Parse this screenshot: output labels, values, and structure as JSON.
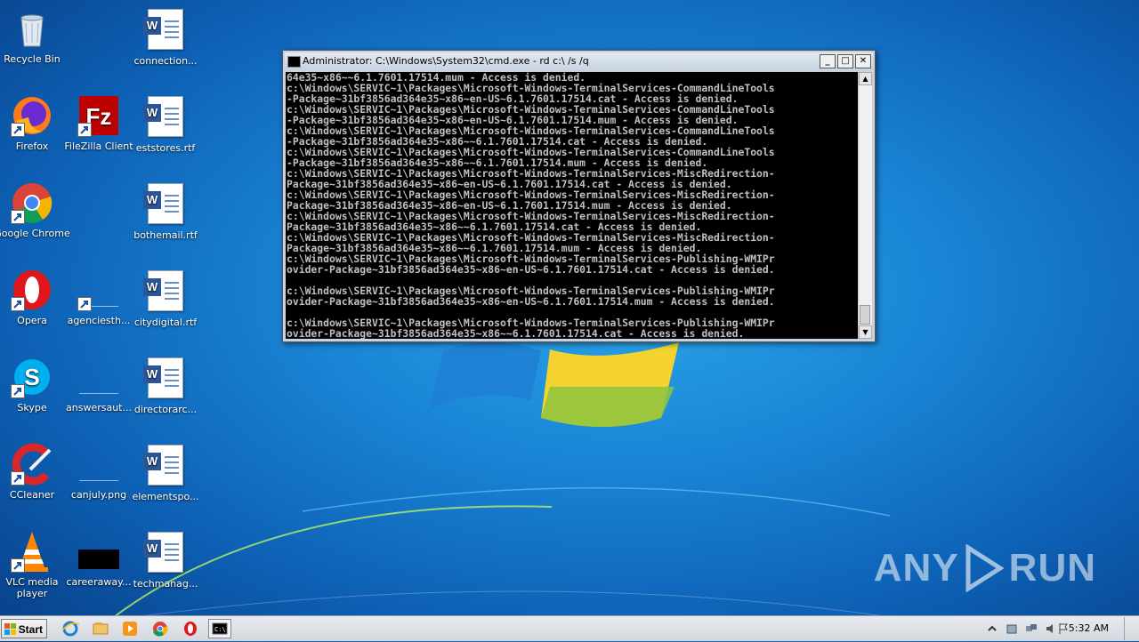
{
  "desktop": {
    "icons": [
      {
        "label": "Recycle Bin"
      },
      {
        "label": "Firefox"
      },
      {
        "label": "Google Chrome"
      },
      {
        "label": "Opera"
      },
      {
        "label": "Skype"
      },
      {
        "label": "CCleaner"
      },
      {
        "label": "VLC media player"
      },
      {
        "label": "connection..."
      },
      {
        "label": "FileZilla Client"
      },
      {
        "label": "eststores.rtf"
      },
      {
        "label": "bothemail.rtf"
      },
      {
        "label": "agenciesth..."
      },
      {
        "label": "citydigital.rtf"
      },
      {
        "label": "answersaut..."
      },
      {
        "label": "directorarc..."
      },
      {
        "label": "canjuly.png"
      },
      {
        "label": "elementspo..."
      },
      {
        "label": "careeraway..."
      },
      {
        "label": "techmanag..."
      }
    ]
  },
  "cmd_window": {
    "title": "Administrator: C:\\Windows\\System32\\cmd.exe - rd  c:\\ /s /q",
    "lines": [
      "64e35~x86~~6.1.7601.17514.mum - Access is denied.",
      "c:\\Windows\\SERVIC~1\\Packages\\Microsoft-Windows-TerminalServices-CommandLineTools",
      "-Package~31bf3856ad364e35~x86~en-US~6.1.7601.17514.cat - Access is denied.",
      "c:\\Windows\\SERVIC~1\\Packages\\Microsoft-Windows-TerminalServices-CommandLineTools",
      "-Package~31bf3856ad364e35~x86~en-US~6.1.7601.17514.mum - Access is denied.",
      "c:\\Windows\\SERVIC~1\\Packages\\Microsoft-Windows-TerminalServices-CommandLineTools",
      "-Package~31bf3856ad364e35~x86~~6.1.7601.17514.cat - Access is denied.",
      "c:\\Windows\\SERVIC~1\\Packages\\Microsoft-Windows-TerminalServices-CommandLineTools",
      "-Package~31bf3856ad364e35~x86~~6.1.7601.17514.mum - Access is denied.",
      "c:\\Windows\\SERVIC~1\\Packages\\Microsoft-Windows-TerminalServices-MiscRedirection-",
      "Package~31bf3856ad364e35~x86~en-US~6.1.7601.17514.cat - Access is denied.",
      "c:\\Windows\\SERVIC~1\\Packages\\Microsoft-Windows-TerminalServices-MiscRedirection-",
      "Package~31bf3856ad364e35~x86~en-US~6.1.7601.17514.mum - Access is denied.",
      "c:\\Windows\\SERVIC~1\\Packages\\Microsoft-Windows-TerminalServices-MiscRedirection-",
      "Package~31bf3856ad364e35~x86~~6.1.7601.17514.cat - Access is denied.",
      "c:\\Windows\\SERVIC~1\\Packages\\Microsoft-Windows-TerminalServices-MiscRedirection-",
      "Package~31bf3856ad364e35~x86~~6.1.7601.17514.mum - Access is denied.",
      "c:\\Windows\\SERVIC~1\\Packages\\Microsoft-Windows-TerminalServices-Publishing-WMIPr",
      "ovider-Package~31bf3856ad364e35~x86~en-US~6.1.7601.17514.cat - Access is denied.",
      "",
      "c:\\Windows\\SERVIC~1\\Packages\\Microsoft-Windows-TerminalServices-Publishing-WMIPr",
      "ovider-Package~31bf3856ad364e35~x86~en-US~6.1.7601.17514.mum - Access is denied.",
      "",
      "c:\\Windows\\SERVIC~1\\Packages\\Microsoft-Windows-TerminalServices-Publishing-WMIPr",
      "ovider-Package~31bf3856ad364e35~x86~~6.1.7601.17514.cat - Access is denied."
    ],
    "buttons": {
      "minimize": "_",
      "maximize": "□",
      "close": "✕"
    }
  },
  "taskbar": {
    "start_label": "Start",
    "clock": "5:32 AM",
    "pinned": [
      "ie-icon",
      "explorer-icon",
      "media-player-icon",
      "chrome-icon",
      "opera-icon",
      "cmd-icon"
    ]
  },
  "watermark": {
    "left": "ANY",
    "right": "RUN"
  }
}
